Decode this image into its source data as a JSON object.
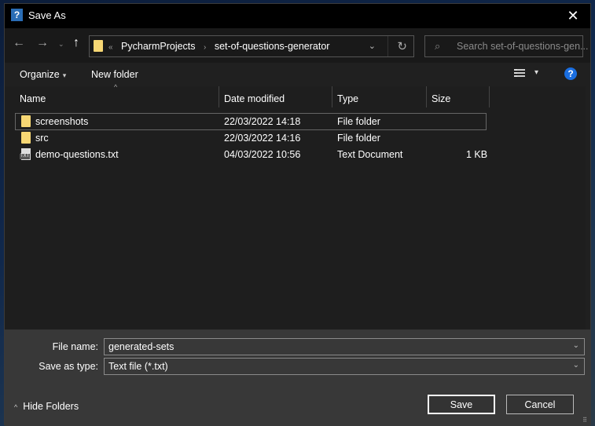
{
  "window": {
    "title": "Save As",
    "app_icon": "question-mark-app-icon",
    "close_icon": "✕"
  },
  "nav": {
    "back_icon": "←",
    "forward_icon": "→",
    "recent_icon": "⌄",
    "up_icon": "↑",
    "breadcrumb_overflow": "«",
    "breadcrumb": [
      "PycharmProjects",
      "set-of-questions-generator"
    ],
    "breadcrumb_sep": "›",
    "dropdown_icon": "⌄",
    "refresh_icon": "↻",
    "search_placeholder": "Search set-of-questions-gen...",
    "search_icon": "⌕"
  },
  "toolbar": {
    "organize_label": "Organize",
    "organize_caret": "▾",
    "new_folder_label": "New folder",
    "view_caret": "▾",
    "help_label": "?"
  },
  "filelist": {
    "sort_indicator": "^",
    "columns": [
      "Name",
      "Date modified",
      "Type",
      "Size"
    ],
    "rows": [
      {
        "icon": "folder",
        "name": "screenshots",
        "date": "22/03/2022 14:18",
        "type": "File folder",
        "size": ""
      },
      {
        "icon": "folder",
        "name": "src",
        "date": "22/03/2022 14:16",
        "type": "File folder",
        "size": ""
      },
      {
        "icon": "text-file",
        "name": "demo-questions.txt",
        "date": "04/03/2022 10:56",
        "type": "Text Document",
        "size": "1 KB"
      }
    ],
    "txt_badge": "TXT"
  },
  "form": {
    "file_name_label": "File name:",
    "file_name_value": "generated-sets",
    "save_type_label": "Save as type:",
    "save_type_value": "Text file (*.txt)",
    "dropdown_icon": "⌄"
  },
  "footer": {
    "hide_folders_label": "Hide Folders",
    "hide_folders_icon": "^",
    "save_label": "Save",
    "cancel_label": "Cancel",
    "grip_icon": "⠿"
  }
}
